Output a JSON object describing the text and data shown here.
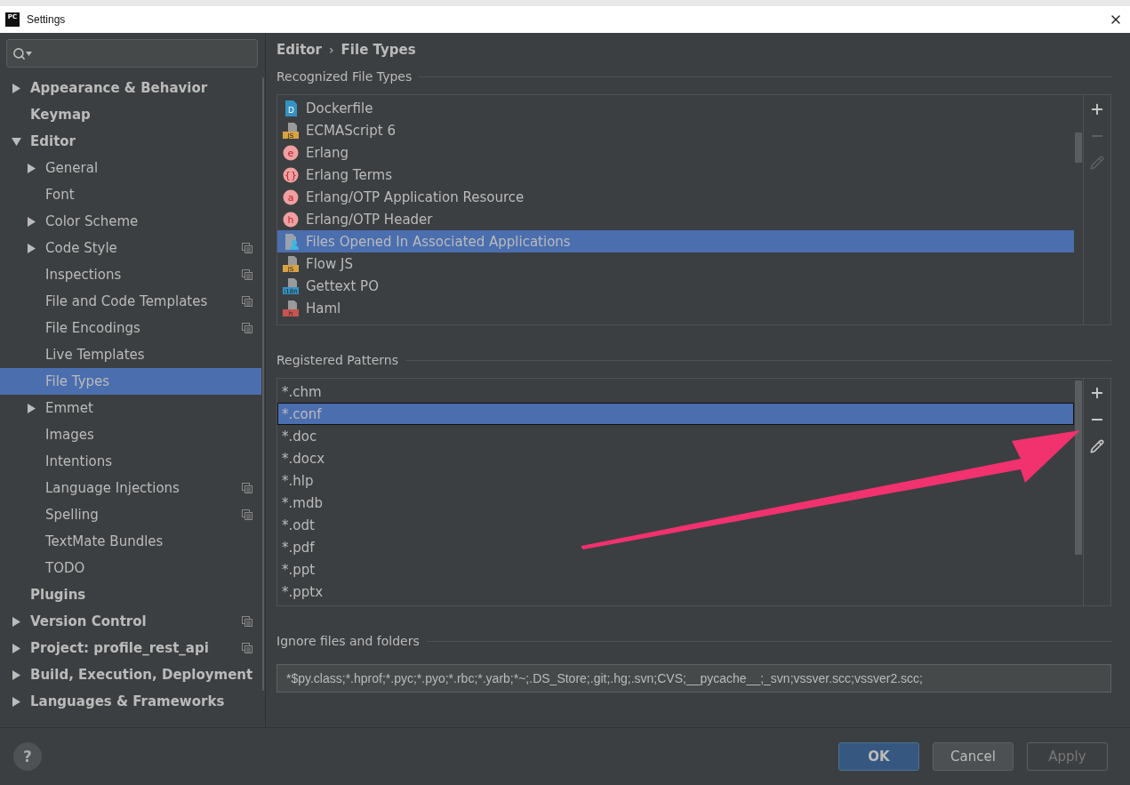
{
  "window": {
    "title": "Settings",
    "app_icon_text": "PC"
  },
  "sidebar": {
    "items": [
      {
        "label": "Appearance & Behavior",
        "kind": "group",
        "expanded": false,
        "shared": false
      },
      {
        "label": "Keymap",
        "kind": "leaf",
        "shared": false
      },
      {
        "label": "Editor",
        "kind": "group",
        "expanded": true,
        "shared": false,
        "children": [
          {
            "label": "General",
            "kind": "group",
            "expanded": false,
            "shared": false,
            "selected": false
          },
          {
            "label": "Font",
            "kind": "leaf",
            "shared": false,
            "selected": false
          },
          {
            "label": "Color Scheme",
            "kind": "group",
            "expanded": false,
            "shared": false,
            "selected": false
          },
          {
            "label": "Code Style",
            "kind": "group",
            "expanded": false,
            "shared": true,
            "selected": false
          },
          {
            "label": "Inspections",
            "kind": "leaf",
            "shared": true,
            "selected": false
          },
          {
            "label": "File and Code Templates",
            "kind": "leaf",
            "shared": true,
            "selected": false
          },
          {
            "label": "File Encodings",
            "kind": "leaf",
            "shared": true,
            "selected": false
          },
          {
            "label": "Live Templates",
            "kind": "leaf",
            "shared": false,
            "selected": false
          },
          {
            "label": "File Types",
            "kind": "leaf",
            "shared": false,
            "selected": true
          },
          {
            "label": "Emmet",
            "kind": "group",
            "expanded": false,
            "shared": false,
            "selected": false
          },
          {
            "label": "Images",
            "kind": "leaf",
            "shared": false,
            "selected": false
          },
          {
            "label": "Intentions",
            "kind": "leaf",
            "shared": false,
            "selected": false
          },
          {
            "label": "Language Injections",
            "kind": "leaf",
            "shared": true,
            "selected": false
          },
          {
            "label": "Spelling",
            "kind": "leaf",
            "shared": true,
            "selected": false
          },
          {
            "label": "TextMate Bundles",
            "kind": "leaf",
            "shared": false,
            "selected": false
          },
          {
            "label": "TODO",
            "kind": "leaf",
            "shared": false,
            "selected": false
          }
        ]
      },
      {
        "label": "Plugins",
        "kind": "leaf",
        "shared": false
      },
      {
        "label": "Version Control",
        "kind": "group",
        "expanded": false,
        "shared": true
      },
      {
        "label": "Project: profile_rest_api",
        "kind": "group",
        "expanded": false,
        "shared": true
      },
      {
        "label": "Build, Execution, Deployment",
        "kind": "group",
        "expanded": false,
        "shared": false
      },
      {
        "label": "Languages & Frameworks",
        "kind": "group",
        "expanded": false,
        "shared": false
      }
    ]
  },
  "breadcrumb": {
    "items": [
      "Editor",
      "File Types"
    ],
    "separator": "›"
  },
  "recognized": {
    "title": "Recognized File Types",
    "rows": [
      {
        "label": "Dockerfile",
        "kind": "doc",
        "icon_text": "D",
        "color": "#3592c4",
        "selected": false
      },
      {
        "label": "ECMAScript 6",
        "kind": "file",
        "icon_text": "JS",
        "color": "#d9a343",
        "selected": false
      },
      {
        "label": "Erlang",
        "kind": "circle",
        "icon_text": "e",
        "color": "#f0a0a0",
        "selected": false
      },
      {
        "label": "Erlang Terms",
        "kind": "circle",
        "icon_text": "{}",
        "color": "#f0a0a0",
        "selected": false
      },
      {
        "label": "Erlang/OTP Application Resource",
        "kind": "circle",
        "icon_text": "a",
        "color": "#f0a0a0",
        "selected": false
      },
      {
        "label": "Erlang/OTP Header",
        "kind": "circle",
        "icon_text": "h",
        "color": "#f0a0a0",
        "selected": false
      },
      {
        "label": "Files Opened In Associated Applications",
        "kind": "person",
        "color": "#40b6e0",
        "selected": true
      },
      {
        "label": "Flow JS",
        "kind": "file",
        "icon_text": "JS",
        "color": "#d9a343",
        "selected": false
      },
      {
        "label": "Gettext PO",
        "kind": "file",
        "icon_text": "i18n",
        "color": "#3592c4",
        "selected": false
      },
      {
        "label": "Haml",
        "kind": "file",
        "icon_text": "h",
        "color": "#c75450",
        "selected": false
      }
    ],
    "tools": [
      {
        "kind": "add",
        "disabled": false
      },
      {
        "kind": "remove",
        "disabled": true
      },
      {
        "kind": "edit",
        "disabled": true
      }
    ]
  },
  "patterns": {
    "title": "Registered Patterns",
    "rows": [
      {
        "label": "*.chm",
        "selected": false
      },
      {
        "label": "*.conf",
        "selected": true
      },
      {
        "label": "*.doc",
        "selected": false
      },
      {
        "label": "*.docx",
        "selected": false
      },
      {
        "label": "*.hlp",
        "selected": false
      },
      {
        "label": "*.mdb",
        "selected": false
      },
      {
        "label": "*.odt",
        "selected": false
      },
      {
        "label": "*.pdf",
        "selected": false
      },
      {
        "label": "*.ppt",
        "selected": false
      },
      {
        "label": "*.pptx",
        "selected": false
      }
    ],
    "tools": [
      {
        "kind": "add",
        "disabled": false
      },
      {
        "kind": "remove",
        "disabled": false
      },
      {
        "kind": "edit",
        "disabled": false
      }
    ]
  },
  "ignore": {
    "title": "Ignore files and folders",
    "value": "*$py.class;*.hprof;*.pyc;*.pyo;*.rbc;*.yarb;*~;.DS_Store;.git;.hg;.svn;CVS;__pycache__;_svn;vssver.scc;vssver2.scc;"
  },
  "help": {
    "label": "?"
  },
  "buttons": [
    {
      "label": "OK",
      "kind": "primary",
      "disabled": false
    },
    {
      "label": "Cancel",
      "kind": "normal",
      "disabled": false
    },
    {
      "label": "Apply",
      "kind": "normal",
      "disabled": true
    }
  ]
}
